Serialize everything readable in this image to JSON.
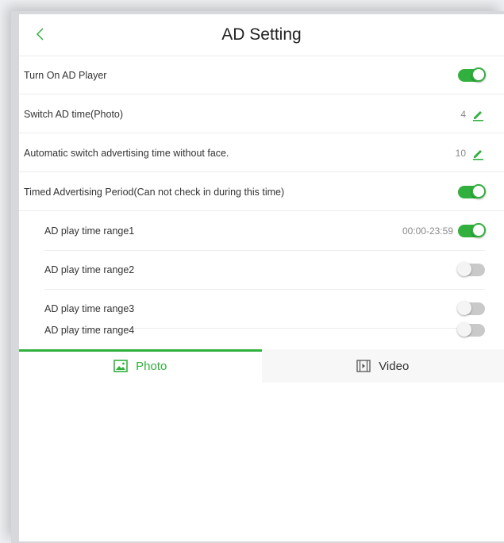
{
  "header": {
    "title": "AD Setting",
    "back_icon": "chevron-left-icon"
  },
  "settings": {
    "ad_player": {
      "label": "Turn On AD Player",
      "enabled": true
    },
    "switch_time": {
      "label": "Switch AD time(Photo)",
      "value": "4"
    },
    "no_face_time": {
      "label": "Automatic switch advertising time without face.",
      "value": "10"
    },
    "timed_period": {
      "label": "Timed Advertising Period(Can not check in during this time)",
      "enabled": true
    }
  },
  "ranges": [
    {
      "label": "AD play time range1",
      "time": "00:00-23:59",
      "enabled": true
    },
    {
      "label": "AD play time range2",
      "time": "",
      "enabled": false
    },
    {
      "label": "AD play time range3",
      "time": "",
      "enabled": false
    },
    {
      "label": "AD play time range4",
      "time": "",
      "enabled": false
    }
  ],
  "tabs": [
    {
      "label": "Photo",
      "icon": "image-icon",
      "active": true
    },
    {
      "label": "Video",
      "icon": "video-icon",
      "active": false
    }
  ],
  "colors": {
    "accent": "#31b03d",
    "toggle_off": "#c9c9c9"
  }
}
